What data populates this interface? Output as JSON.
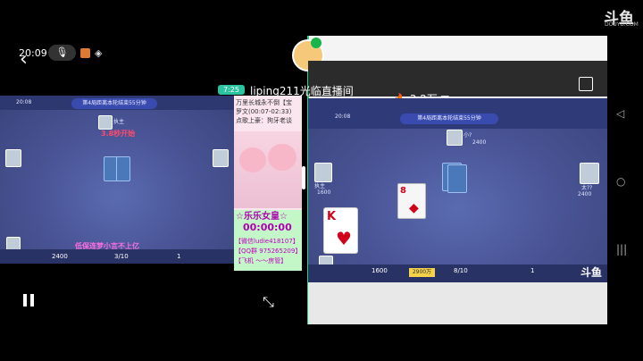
{
  "status_bar": {
    "time": "20:09"
  },
  "brand": {
    "logo": "斗鱼",
    "sub": "DOUYU.COM"
  },
  "room": {
    "badge": "7:25",
    "title": "liping211光临直播间",
    "popularity": "3.2万"
  },
  "left_game": {
    "time": "20:08",
    "title": "第4局距离本轮结束55分钟",
    "countdown_text": "3.8秒开始",
    "player_label": "执主",
    "banner": "低保连梦小言不上亿",
    "bottom_score": "2400",
    "bottom_round": "3/10",
    "bottom_right": "1"
  },
  "middle_panel": {
    "line1": "万里长城永不倒【宝",
    "line2": "罗文(00:07-02:33)",
    "line3": "点歌上豪：狗牙老谈",
    "highlight": "☆乐乐女皇☆",
    "timer": "00:00:00",
    "contact1": "【微信ludie418107】",
    "contact2": "【QQ群 975265209】",
    "contact3": "【飞机 ～～房管】"
  },
  "right_game": {
    "time": "20:08",
    "title": "第4局距离本轮结束55分钟",
    "player_top": "小?",
    "player_top_score": "2400",
    "player_left": "执主",
    "player_left_score": "1600",
    "player_right": "太??",
    "player_right_score": "2400",
    "card_rank": "K",
    "card_suit": "♥",
    "played_rank": "8",
    "played_suit": "◆",
    "bottom_score": "1600",
    "bottom_round": "8/10",
    "bottom_right": "1",
    "yellow_tag": "2900万",
    "watermark": "斗鱼"
  },
  "controls": {
    "shrink_icon": "⤡"
  },
  "colors": {
    "accent_green": "#2fd07f",
    "table_blue": "#4a5597"
  }
}
